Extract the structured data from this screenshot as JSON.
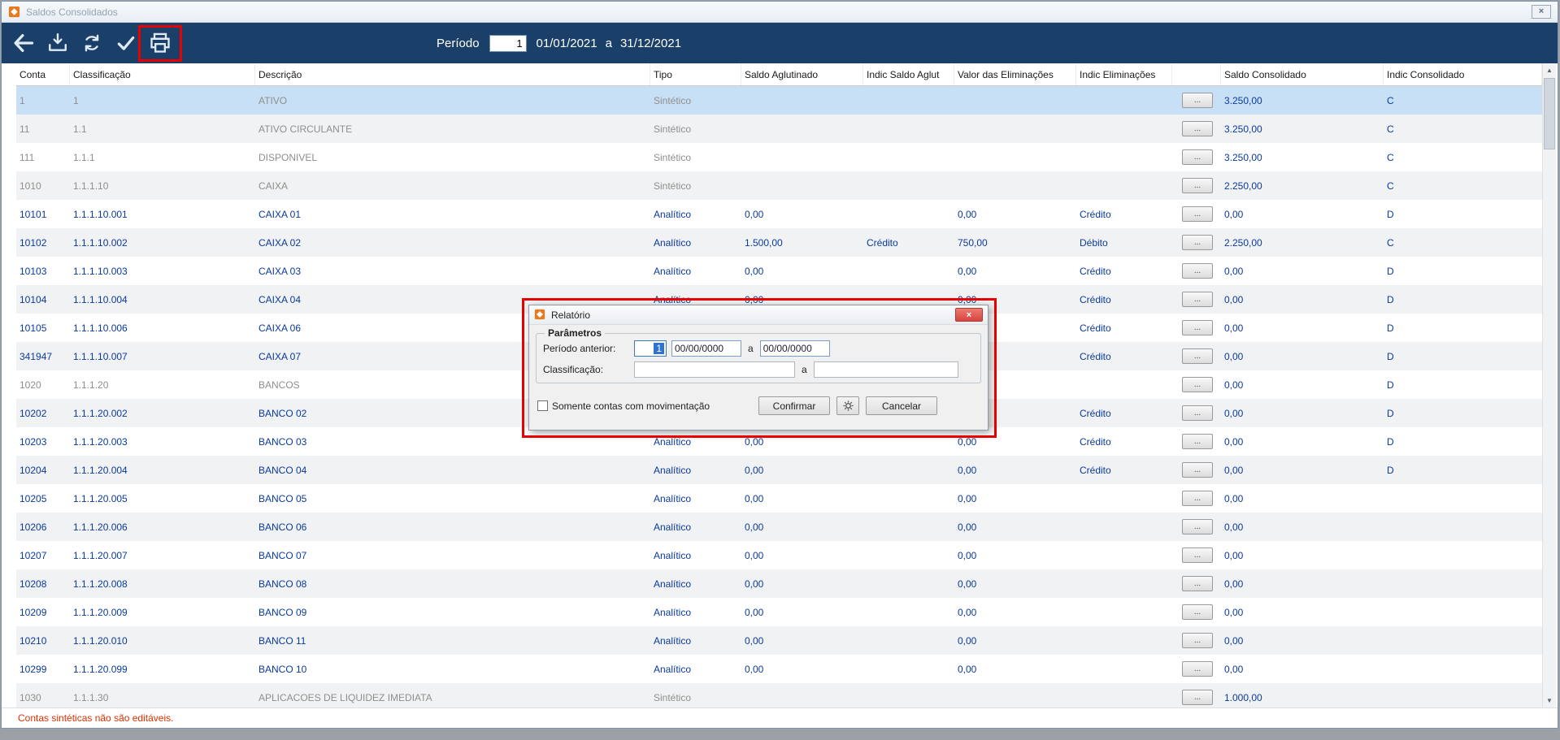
{
  "window": {
    "title": "Saldos Consolidados"
  },
  "toolbar": {
    "period_label": "Período",
    "period_number": "1",
    "date_start": "01/01/2021",
    "date_separator": "a",
    "date_end": "31/12/2021"
  },
  "table": {
    "columns": [
      {
        "key": "conta",
        "label": "Conta"
      },
      {
        "key": "classificacao",
        "label": "Classificação"
      },
      {
        "key": "descricao",
        "label": "Descrição"
      },
      {
        "key": "tipo",
        "label": "Tipo"
      },
      {
        "key": "saldo_aglutinado",
        "label": "Saldo Aglutinado"
      },
      {
        "key": "indic_saldo_aglut",
        "label": "Indic Saldo Aglut"
      },
      {
        "key": "valor_eliminacoes",
        "label": "Valor das Eliminações"
      },
      {
        "key": "indic_eliminacoes",
        "label": "Indic Eliminações"
      },
      {
        "key": "acoes",
        "label": ""
      },
      {
        "key": "saldo_consolidado",
        "label": "Saldo Consolidado"
      },
      {
        "key": "indic_consolidado",
        "label": "Indic Consolidado"
      }
    ],
    "row_button_label": "...",
    "rows": [
      {
        "conta": "1",
        "classificacao": "1",
        "descricao": "ATIVO",
        "tipo": "Sintético",
        "saldo_consolidado": "3.250,00",
        "indic_consolidado": "C",
        "kind": "sint",
        "selected": true
      },
      {
        "conta": "11",
        "classificacao": "1.1",
        "descricao": "ATIVO CIRCULANTE",
        "tipo": "Sintético",
        "saldo_consolidado": "3.250,00",
        "indic_consolidado": "C",
        "kind": "sint"
      },
      {
        "conta": "111",
        "classificacao": "1.1.1",
        "descricao": "DISPONIVEL",
        "tipo": "Sintético",
        "saldo_consolidado": "3.250,00",
        "indic_consolidado": "C",
        "kind": "sint"
      },
      {
        "conta": "1010",
        "classificacao": "1.1.1.10",
        "descricao": "CAIXA",
        "tipo": "Sintético",
        "saldo_consolidado": "2.250,00",
        "indic_consolidado": "C",
        "kind": "sint"
      },
      {
        "conta": "10101",
        "classificacao": "1.1.1.10.001",
        "descricao": "CAIXA 01",
        "tipo": "Analítico",
        "saldo_aglutinado": "0,00",
        "valor_eliminacoes": "0,00",
        "indic_eliminacoes": "Crédito",
        "saldo_consolidado": "0,00",
        "indic_consolidado": "D",
        "kind": "anal"
      },
      {
        "conta": "10102",
        "classificacao": "1.1.1.10.002",
        "descricao": "CAIXA 02",
        "tipo": "Analítico",
        "saldo_aglutinado": "1.500,00",
        "indic_saldo_aglut": "Crédito",
        "valor_eliminacoes": "750,00",
        "indic_eliminacoes": "Débito",
        "saldo_consolidado": "2.250,00",
        "indic_consolidado": "C",
        "kind": "anal"
      },
      {
        "conta": "10103",
        "classificacao": "1.1.1.10.003",
        "descricao": "CAIXA 03",
        "tipo": "Analítico",
        "saldo_aglutinado": "0,00",
        "valor_eliminacoes": "0,00",
        "indic_eliminacoes": "Crédito",
        "saldo_consolidado": "0,00",
        "indic_consolidado": "D",
        "kind": "anal"
      },
      {
        "conta": "10104",
        "classificacao": "1.1.1.10.004",
        "descricao": "CAIXA 04",
        "tipo": "Analítico",
        "saldo_aglutinado": "0,00",
        "valor_eliminacoes": "0,00",
        "indic_eliminacoes": "Crédito",
        "saldo_consolidado": "0,00",
        "indic_consolidado": "D",
        "kind": "anal"
      },
      {
        "conta": "10105",
        "classificacao": "1.1.1.10.006",
        "descricao": "CAIXA 06",
        "indic_eliminacoes": "Crédito",
        "saldo_consolidado": "0,00",
        "indic_consolidado": "D",
        "kind": "anal"
      },
      {
        "conta": "341947",
        "classificacao": "1.1.1.10.007",
        "descricao": "CAIXA 07",
        "indic_eliminacoes": "Crédito",
        "saldo_consolidado": "0,00",
        "indic_consolidado": "D",
        "kind": "anal"
      },
      {
        "conta": "1020",
        "classificacao": "1.1.1.20",
        "descricao": "BANCOS",
        "saldo_consolidado": "0,00",
        "indic_consolidado": "D",
        "kind": "sint"
      },
      {
        "conta": "10202",
        "classificacao": "1.1.1.20.002",
        "descricao": "BANCO 02",
        "indic_eliminacoes": "Crédito",
        "saldo_consolidado": "0,00",
        "indic_consolidado": "D",
        "kind": "anal"
      },
      {
        "conta": "10203",
        "classificacao": "1.1.1.20.003",
        "descricao": "BANCO 03",
        "tipo": "Analítico",
        "saldo_aglutinado": "0,00",
        "valor_eliminacoes": "0,00",
        "indic_eliminacoes": "Crédito",
        "saldo_consolidado": "0,00",
        "indic_consolidado": "D",
        "kind": "anal"
      },
      {
        "conta": "10204",
        "classificacao": "1.1.1.20.004",
        "descricao": "BANCO 04",
        "tipo": "Analítico",
        "saldo_aglutinado": "0,00",
        "valor_eliminacoes": "0,00",
        "indic_eliminacoes": "Crédito",
        "saldo_consolidado": "0,00",
        "indic_consolidado": "D",
        "kind": "anal"
      },
      {
        "conta": "10205",
        "classificacao": "1.1.1.20.005",
        "descricao": "BANCO 05",
        "tipo": "Analítico",
        "saldo_aglutinado": "0,00",
        "valor_eliminacoes": "0,00",
        "saldo_consolidado": "0,00",
        "kind": "anal"
      },
      {
        "conta": "10206",
        "classificacao": "1.1.1.20.006",
        "descricao": "BANCO 06",
        "tipo": "Analítico",
        "saldo_aglutinado": "0,00",
        "valor_eliminacoes": "0,00",
        "saldo_consolidado": "0,00",
        "kind": "anal"
      },
      {
        "conta": "10207",
        "classificacao": "1.1.1.20.007",
        "descricao": "BANCO 07",
        "tipo": "Analítico",
        "saldo_aglutinado": "0,00",
        "valor_eliminacoes": "0,00",
        "saldo_consolidado": "0,00",
        "kind": "anal"
      },
      {
        "conta": "10208",
        "classificacao": "1.1.1.20.008",
        "descricao": "BANCO 08",
        "tipo": "Analítico",
        "saldo_aglutinado": "0,00",
        "valor_eliminacoes": "0,00",
        "saldo_consolidado": "0,00",
        "kind": "anal"
      },
      {
        "conta": "10209",
        "classificacao": "1.1.1.20.009",
        "descricao": "BANCO 09",
        "tipo": "Analítico",
        "saldo_aglutinado": "0,00",
        "valor_eliminacoes": "0,00",
        "saldo_consolidado": "0,00",
        "kind": "anal"
      },
      {
        "conta": "10210",
        "classificacao": "1.1.1.20.010",
        "descricao": "BANCO 11",
        "tipo": "Analítico",
        "saldo_aglutinado": "0,00",
        "valor_eliminacoes": "0,00",
        "saldo_consolidado": "0,00",
        "kind": "anal"
      },
      {
        "conta": "10299",
        "classificacao": "1.1.1.20.099",
        "descricao": "BANCO 10",
        "tipo": "Analítico",
        "saldo_aglutinado": "0,00",
        "valor_eliminacoes": "0,00",
        "saldo_consolidado": "0,00",
        "kind": "anal"
      },
      {
        "conta": "1030",
        "classificacao": "1.1.1.30",
        "descricao": "APLICACOES DE LIQUIDEZ IMEDIATA",
        "tipo": "Sintético",
        "saldo_consolidado": "1.000,00",
        "kind": "sint"
      }
    ]
  },
  "status": {
    "message": "Contas sintéticas não são editáveis."
  },
  "dialog": {
    "title": "Relatório",
    "group_label": "Parâmetros",
    "period_label": "Período anterior:",
    "period_value": "1",
    "date_from": "00/00/0000",
    "date_to": "00/00/0000",
    "range_separator": "a",
    "classification_label": "Classificação:",
    "classification_from": "",
    "classification_to": "",
    "checkbox_label": "Somente contas com movimentação",
    "checkbox_checked": false,
    "confirm_label": "Confirmar",
    "cancel_label": "Cancelar"
  },
  "icons": {
    "titlebar": [
      "app-icon",
      "close-icon"
    ],
    "toolbar": [
      "back-icon",
      "import-icon",
      "refresh-icon",
      "confirm-icon",
      "print-icon"
    ],
    "dialog": [
      "report-icon",
      "close-icon",
      "gear-icon"
    ],
    "scrollbar": [
      "scroll-up-icon",
      "scroll-down-icon"
    ]
  },
  "colors": {
    "toolbar_bg": "#1a3f68",
    "selected_row": "#c8e0f5",
    "analitico_text": "#0a3a9e",
    "sintetico_text": "#8e8e8e",
    "annotation": "#e60000",
    "status_text": "#e03000"
  }
}
